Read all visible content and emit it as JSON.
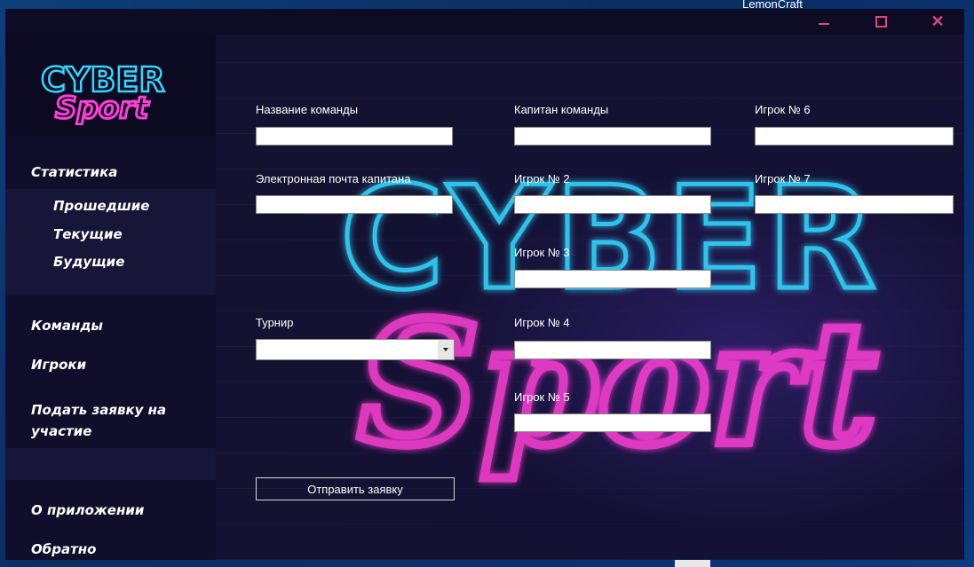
{
  "desktop": {
    "label": "LemonCraft"
  },
  "window": {
    "controls": {
      "minimize_icon": "minimize-icon",
      "maximize_icon": "maximize-icon",
      "close_icon": "close-icon"
    }
  },
  "sidebar": {
    "logo": {
      "top": "CYBER",
      "bottom": "Sport"
    },
    "statistics": "Статистика",
    "sub_items": [
      "Прошедшие",
      "Текущие",
      "Будущие"
    ],
    "teams": "Команды",
    "players": "Игроки",
    "apply_line1": "Подать заявку на",
    "apply_line2": "участие",
    "about": "О приложении",
    "back": "Обратно"
  },
  "background_art": {
    "word1": "CYBER",
    "word2": "Sport"
  },
  "form": {
    "team_name": {
      "label": "Название команды",
      "value": ""
    },
    "captain_email": {
      "label": "Электронная почта капитана",
      "value": ""
    },
    "tournament": {
      "label": "Турнир",
      "value": ""
    },
    "captain": {
      "label": "Капитан команды",
      "value": ""
    },
    "player2": {
      "label": "Игрок № 2",
      "value": ""
    },
    "player3": {
      "label": "Игрок № 3",
      "value": ""
    },
    "player4": {
      "label": "Игрок № 4",
      "value": ""
    },
    "player5": {
      "label": "Игрок № 5",
      "value": ""
    },
    "player6": {
      "label": "Игрок № 6",
      "value": ""
    },
    "player7": {
      "label": "Игрок № 7",
      "value": ""
    },
    "submit_label": "Отправить заявку"
  },
  "colors": {
    "accent_pink": "#e0457d",
    "neon_cyan": "#33d6ff",
    "neon_magenta": "#ff3fd8"
  }
}
